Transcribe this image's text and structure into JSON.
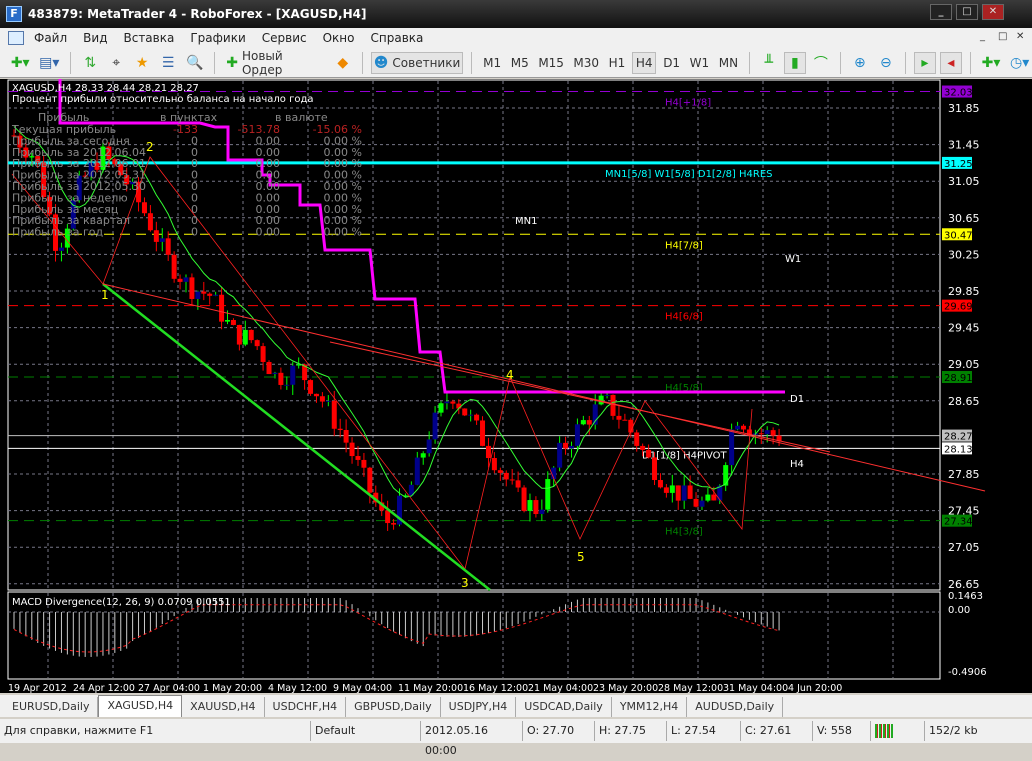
{
  "window": {
    "title": "483879: MetaTrader 4 - RoboForex - [XAGUSD,H4]",
    "logo": "F",
    "min": "_",
    "max": "□",
    "close": "✕"
  },
  "menu": [
    "Файл",
    "Вид",
    "Вставка",
    "Графики",
    "Сервис",
    "Окно",
    "Справка"
  ],
  "toolbar": {
    "new_order": "Новый Ордер",
    "experts": "Советники",
    "timeframes": [
      "M1",
      "M5",
      "M15",
      "M30",
      "H1",
      "H4",
      "D1",
      "W1",
      "MN"
    ],
    "active_tf": "H4"
  },
  "chart": {
    "header": "XAGUSD,H4  28.33 28.44 28.21 28.27",
    "subtitle": "Процент прибыли относительно баланса на начало года",
    "profit_table": {
      "headers": [
        "Прибыль",
        "в пунктах",
        "в валюте"
      ],
      "rows": [
        [
          "Текущая прибыль",
          "-133",
          "-513.78",
          "-15.06 %"
        ],
        [
          "Прибыль за сегодня",
          "0",
          "0.00",
          "0.00 %"
        ],
        [
          "Прибыль за 2012.06.04",
          "0",
          "0.00",
          "0.00 %"
        ],
        [
          "Прибыль за 2012.06.01",
          "0",
          "0.00",
          "0.00 %"
        ],
        [
          "Прибыль за 2012.05.31",
          "0",
          "0.00",
          "0.00 %"
        ],
        [
          "Прибыль за 2012.05.30",
          "0",
          "0.00",
          "0.00 %"
        ],
        [
          "Прибыль за неделю",
          "0",
          "0.00",
          "0.00 %"
        ],
        [
          "Прибыль за месяц",
          "0",
          "0.00",
          "0.00 %"
        ],
        [
          "Прибыль за квартал",
          "0",
          "0.00",
          "0.00 %"
        ],
        [
          "Прибыль за год",
          "0",
          "0.00",
          "0.00 %"
        ]
      ]
    },
    "price_ticks": [
      "31.85",
      "31.45",
      "31.05",
      "30.65",
      "30.25",
      "29.85",
      "29.45",
      "29.05",
      "28.65",
      "27.85",
      "27.45",
      "27.05",
      "26.65"
    ],
    "levels": [
      {
        "price": 32.03,
        "label": "32.03",
        "color": "#9400d3",
        "text": "H4[+1/8]",
        "dash": true
      },
      {
        "price": 31.25,
        "label": "31.25",
        "color": "#00ffff",
        "text": "MN1[5/8] W1[5/8] D1[2/8] H4RES",
        "dash": false
      },
      {
        "price": 30.47,
        "label": "30.47",
        "color": "#ffff00",
        "text": "H4[7/8]",
        "dash": true
      },
      {
        "price": 29.69,
        "label": "29.69",
        "color": "#ff0000",
        "text": "H4[6/8]",
        "dash": true
      },
      {
        "price": 28.91,
        "label": "28.91",
        "color": "#008000",
        "text": "H4[5/8]",
        "dash": true
      },
      {
        "price": 27.34,
        "label": "27.34",
        "color": "#008000",
        "text": "H4[3/8]",
        "dash": true
      },
      {
        "price": 28.27,
        "label": "28.27",
        "color": "#c0c0c0",
        "text": "",
        "dash": false
      },
      {
        "price": 28.13,
        "label": "28.13",
        "color": "#ffffff",
        "text": "D1[1/8] H4PIVOT",
        "dash": false
      }
    ],
    "tf_labels": [
      "MN1",
      "W1",
      "D1",
      "H4"
    ],
    "wave_labels": [
      "1",
      "2",
      "3",
      "4",
      "5"
    ],
    "keypoints": [
      31.55,
      31.3,
      30.3,
      31.0,
      31.35,
      31.1,
      30.7,
      30.2,
      29.9,
      29.8,
      29.4,
      29.3,
      28.9,
      29.0,
      28.7,
      28.3,
      27.8,
      27.3,
      27.6,
      28.3,
      28.75,
      28.4,
      28.0,
      27.6,
      27.45,
      28.1,
      28.4,
      28.65,
      28.4,
      28.0,
      27.7,
      27.55,
      27.5,
      28.5,
      28.3,
      28.27
    ],
    "macd": {
      "label": "MACD Divergence(12, 26, 9) 0.0709 0.0551",
      "ticks": [
        "0.1463",
        "0.00",
        "-0.4906"
      ]
    },
    "time_labels": [
      "19 Apr 2012",
      "24 Apr 12:00",
      "27 Apr 04:00",
      "1 May 20:00",
      "4 May 12:00",
      "9 May 04:00",
      "11 May 20:00",
      "16 May 12:00",
      "21 May 04:00",
      "23 May 20:00",
      "28 May 12:00",
      "31 May 04:00",
      "4 Jun 20:00"
    ]
  },
  "tabs": [
    "EURUSD,Daily",
    "XAGUSD,H4",
    "XAUUSD,H4",
    "USDCHF,H4",
    "GBPUSD,Daily",
    "USDJPY,H4",
    "USDCAD,Daily",
    "YMM12,H4",
    "AUDUSD,Daily"
  ],
  "active_tab": "XAGUSD,H4",
  "status": {
    "help": "Для справки, нажмите F1",
    "profile": "Default",
    "datetime": "2012.05.16 00:00",
    "open": "O: 27.70",
    "high": "H: 27.75",
    "low": "L: 27.54",
    "close": "C: 27.61",
    "volume": "V: 558",
    "traffic": "152/2 kb"
  }
}
